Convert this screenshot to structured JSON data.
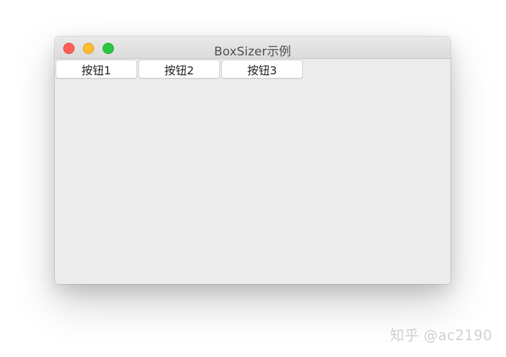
{
  "window": {
    "title": "BoxSizer示例"
  },
  "buttons": [
    {
      "label": "按钮1"
    },
    {
      "label": "按钮2"
    },
    {
      "label": "按钮3"
    }
  ],
  "watermark": {
    "text": "知乎 @ac2190"
  },
  "colors": {
    "close": "#ff5f57",
    "minimize": "#febc2e",
    "maximize": "#28c840",
    "window_bg": "#ececec"
  }
}
